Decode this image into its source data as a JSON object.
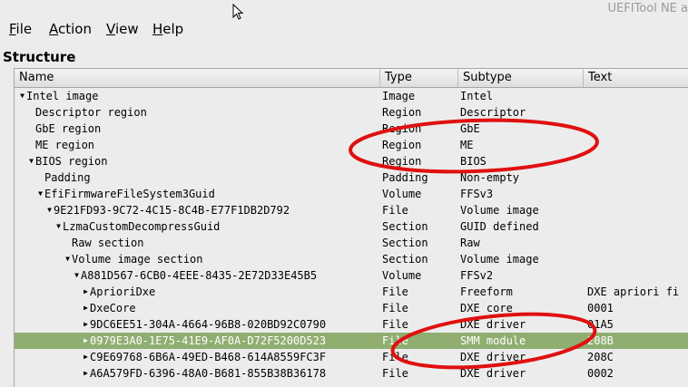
{
  "window": {
    "title": "UEFITool NE a"
  },
  "menu": [
    {
      "label": "File",
      "mnemonic": "F",
      "rest": "ile"
    },
    {
      "label": "Action",
      "mnemonic": "A",
      "rest": "ction"
    },
    {
      "label": "View",
      "mnemonic": "V",
      "rest": "iew"
    },
    {
      "label": "Help",
      "mnemonic": "H",
      "rest": "elp"
    }
  ],
  "structure_title": "Structure",
  "columns": [
    "Name",
    "Type",
    "Subtype",
    "Text"
  ],
  "rows": [
    {
      "arrow": "down",
      "name": "Intel image",
      "type": "Image",
      "subtype": "Intel",
      "text": ""
    },
    {
      "arrow": "none",
      "name": "Descriptor region",
      "type": "Region",
      "subtype": "Descriptor",
      "text": ""
    },
    {
      "arrow": "none",
      "name": "GbE region",
      "type": "Region",
      "subtype": "GbE",
      "text": ""
    },
    {
      "arrow": "none",
      "name": "ME region",
      "type": "Region",
      "subtype": "ME",
      "text": ""
    },
    {
      "arrow": "down",
      "name": "BIOS region",
      "type": "Region",
      "subtype": "BIOS",
      "text": ""
    },
    {
      "arrow": "none",
      "name": "Padding",
      "type": "Padding",
      "subtype": "Non-empty",
      "text": ""
    },
    {
      "arrow": "down",
      "name": "EfiFirmwareFileSystem3Guid",
      "type": "Volume",
      "subtype": "FFSv3",
      "text": ""
    },
    {
      "arrow": "down",
      "name": "9E21FD93-9C72-4C15-8C4B-E77F1DB2D792",
      "type": "File",
      "subtype": "Volume image",
      "text": ""
    },
    {
      "arrow": "down",
      "name": "LzmaCustomDecompressGuid",
      "type": "Section",
      "subtype": "GUID defined",
      "text": ""
    },
    {
      "arrow": "none",
      "name": "Raw section",
      "type": "Section",
      "subtype": "Raw",
      "text": ""
    },
    {
      "arrow": "down",
      "name": "Volume image section",
      "type": "Section",
      "subtype": "Volume image",
      "text": ""
    },
    {
      "arrow": "down",
      "name": "A881D567-6CB0-4EEE-8435-2E72D33E45B5",
      "type": "Volume",
      "subtype": "FFSv2",
      "text": ""
    },
    {
      "arrow": "right",
      "name": "AprioriDxe",
      "type": "File",
      "subtype": "Freeform",
      "text": "DXE apriori fi"
    },
    {
      "arrow": "right",
      "name": "DxeCore",
      "type": "File",
      "subtype": "DXE core",
      "text": "0001"
    },
    {
      "arrow": "right",
      "name": "9DC6EE51-304A-4664-96B8-020BD92C0790",
      "type": "File",
      "subtype": "DXE driver",
      "text": "01A5"
    },
    {
      "arrow": "right",
      "name": "0979E3A0-1E75-41E9-AF0A-D72F5200D523",
      "type": "File",
      "subtype": "SMM module",
      "text": "208B"
    },
    {
      "arrow": "right",
      "name": "C9E69768-6B6A-49ED-B468-614A8559FC3F",
      "type": "File",
      "subtype": "DXE driver",
      "text": "208C"
    },
    {
      "arrow": "right",
      "name": "A6A579FD-6396-48A0-B681-855B38B36178",
      "type": "File",
      "subtype": "DXE driver",
      "text": "0002"
    }
  ],
  "selected_row": 15,
  "colors": {
    "selected": "#8fae70",
    "annotation": "#e01010"
  }
}
